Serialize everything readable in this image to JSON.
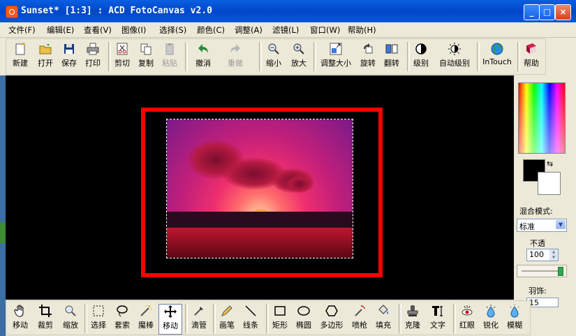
{
  "window": {
    "title": "Sunset* [1:3] : ACD FotoCanvas v2.0",
    "minimize": "_",
    "maximize": "□",
    "close": "×"
  },
  "menu": [
    "文件(F)",
    "编辑(E)",
    "查看(V)",
    "图像(I)",
    "选择(S)",
    "颜色(C)",
    "调整(A)",
    "滤镜(L)",
    "窗口(W)",
    "帮助(H)"
  ],
  "toolbar": {
    "new": "新建",
    "open": "打开",
    "save": "保存",
    "print": "打印",
    "cut": "剪切",
    "copy": "复制",
    "paste": "粘贴",
    "undo": "撤消",
    "redo": "重做",
    "zoom_out": "缩小",
    "zoom_in": "放大",
    "resize": "调整大小",
    "rotate": "旋转",
    "flip": "翻转",
    "levels": "级别",
    "auto_levels": "自动级别",
    "intouch": "InTouch",
    "help": "帮助"
  },
  "right_panel": {
    "blend_mode_label": "混合模式:",
    "blend_mode_value": "标准",
    "opacity_label": "不透",
    "opacity_value": "100",
    "feather_label": "羽饰:",
    "feather_value": "15"
  },
  "bottom_tools": {
    "move_view": "移动",
    "crop": "裁剪",
    "zoom": "缩放",
    "select": "选择",
    "lasso": "套索",
    "magic_wand": "魔棒",
    "move": "移动",
    "eyedropper": "滴管",
    "pencil": "画笔",
    "line": "线条",
    "rectangle": "矩形",
    "ellipse": "椭圆",
    "polygon": "多边形",
    "airbrush": "喷枪",
    "fill": "填充",
    "clone": "克隆",
    "text": "文字",
    "red_eye": "红眼",
    "sharpen": "锐化",
    "blur": "模糊"
  },
  "colors": {
    "foreground": "#000000",
    "background": "#ffffff",
    "highlight": "#ff0000"
  }
}
